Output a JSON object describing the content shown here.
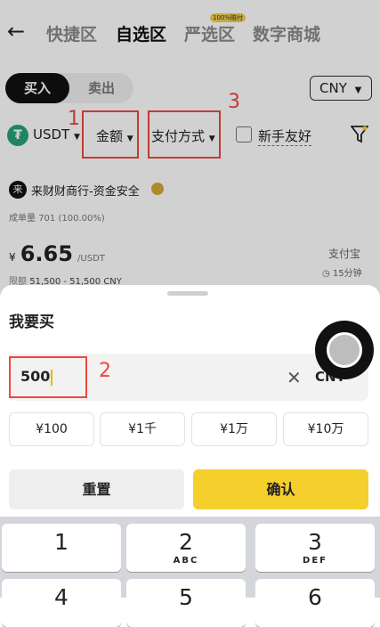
{
  "nav": {
    "tabs": [
      "快捷区",
      "自选区",
      "严选区",
      "数字商城"
    ],
    "badge": "100%赔付"
  },
  "trade": {
    "buy": "买入",
    "sell": "卖出",
    "currency": "CNY"
  },
  "filters": {
    "coin": "USDT",
    "amount": "金额",
    "payment": "支付方式",
    "newbie": "新手友好"
  },
  "annotations": [
    "1",
    "2",
    "3"
  ],
  "merchant": {
    "name": "来财财商行-资金安全",
    "deals_label": "成单量",
    "deals": "701 (100.00%)",
    "currency_symbol": "¥",
    "price": "6.65",
    "unit": "/USDT",
    "limit_label": "限额",
    "limit": "51,500 - 51,500 CNY",
    "pay_method": "支付宝",
    "time": "15分钟"
  },
  "sheet": {
    "title": "我要买",
    "amount_value": "500",
    "currency": "CNY",
    "quick_amounts": [
      "¥100",
      "¥1千",
      "¥1万",
      "¥10万"
    ],
    "reset": "重置",
    "confirm": "确认"
  },
  "keypad": [
    {
      "num": "1",
      "letters": ""
    },
    {
      "num": "2",
      "letters": "ABC"
    },
    {
      "num": "3",
      "letters": "DEF"
    },
    {
      "num": "4",
      "letters": ""
    },
    {
      "num": "5",
      "letters": ""
    },
    {
      "num": "6",
      "letters": ""
    }
  ],
  "colors": {
    "accent": "#f5cf2b",
    "annotation": "#f0473d",
    "tether": "#26a17b"
  }
}
